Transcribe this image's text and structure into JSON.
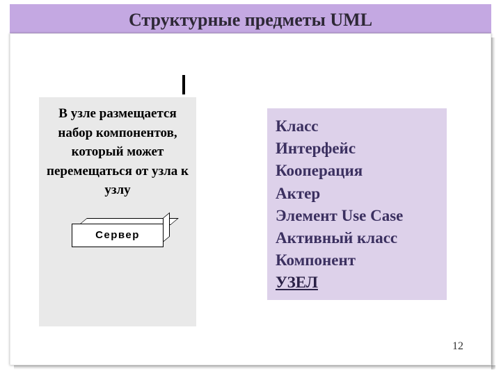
{
  "title": "Структурные предметы UML",
  "left": {
    "description": "В узле размещается набор компонентов, который может перемещаться от узла к узлу",
    "server_label": "Сервер"
  },
  "right": {
    "items": [
      "Класс",
      "Интерфейс",
      "Кооперация",
      "Актер",
      "Элемент Use Case",
      "Активный класс",
      "Компонент"
    ],
    "emphasized": "УЗЕЛ"
  },
  "page_number": "12"
}
